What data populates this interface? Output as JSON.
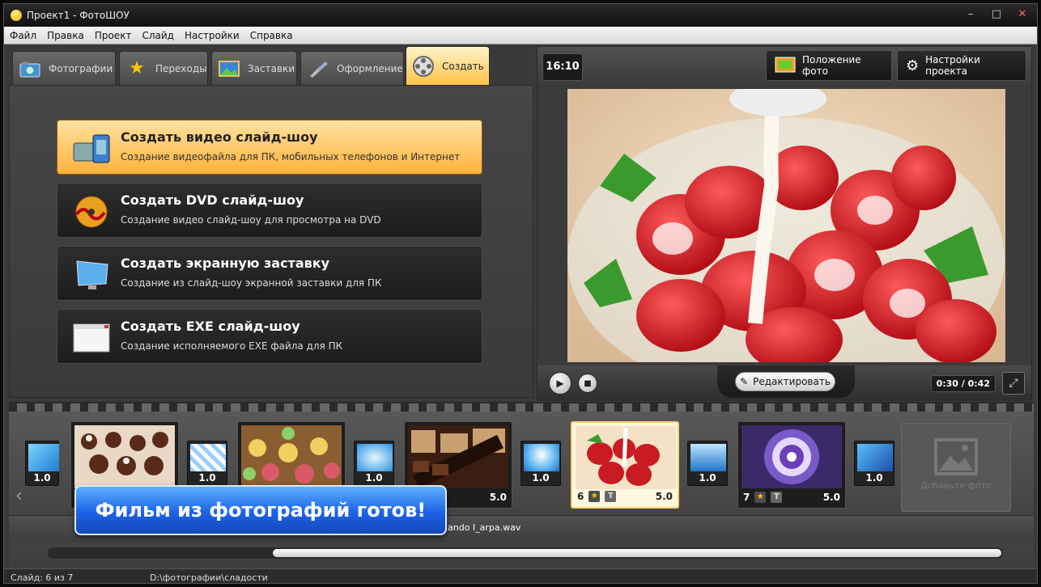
{
  "window": {
    "title": "Проект1 - ФотоШОУ"
  },
  "menu": [
    "Файл",
    "Правка",
    "Проект",
    "Слайд",
    "Настройки",
    "Справка"
  ],
  "tabs": [
    {
      "label": "Фотографии"
    },
    {
      "label": "Переходы"
    },
    {
      "label": "Заставки"
    },
    {
      "label": "Оформление"
    },
    {
      "label": "Создать",
      "active": true
    }
  ],
  "create_options": [
    {
      "title": "Создать видео слайд-шоу",
      "desc": "Создание видеофайла для ПК, мобильных телефонов и Интернет",
      "active": true
    },
    {
      "title": "Создать DVD слайд-шоу",
      "desc": "Создание видео слайд-шоу для просмотра на DVD"
    },
    {
      "title": "Создать экранную заставку",
      "desc": "Создание из слайд-шоу экранной заставки для ПК"
    },
    {
      "title": "Создать EXE слайд-шоу",
      "desc": "Создание исполняемого EXE файла для ПК"
    }
  ],
  "preview": {
    "ratio": "16:10",
    "photo_position_label": "Положение фото",
    "project_settings_label": "Настройки проекта",
    "edit_label": "Редактировать",
    "time": "0:30 / 0:42"
  },
  "timeline": {
    "transitions": [
      "1.0",
      "1.0",
      "1.0",
      "1.0",
      "1.0",
      "1.0"
    ],
    "slides": [
      {
        "num": "",
        "dur": ""
      },
      {
        "num": "",
        "dur": ""
      },
      {
        "num": "",
        "dur": "5.0"
      },
      {
        "num": "6",
        "dur": "5.0",
        "selected": true
      },
      {
        "num": "7",
        "dur": "5.0"
      }
    ],
    "add_photo_label": "Добавьте фото",
    "audio_file": "ando I_arpa.wav"
  },
  "banner": "Фильм из фотографий готов!",
  "status": {
    "slide": "Слайд: 6 из 7",
    "path": "D:\\фотографии\\сладости"
  },
  "colors": {
    "accent": "#ffb13b",
    "banner": "#1d63e6"
  }
}
